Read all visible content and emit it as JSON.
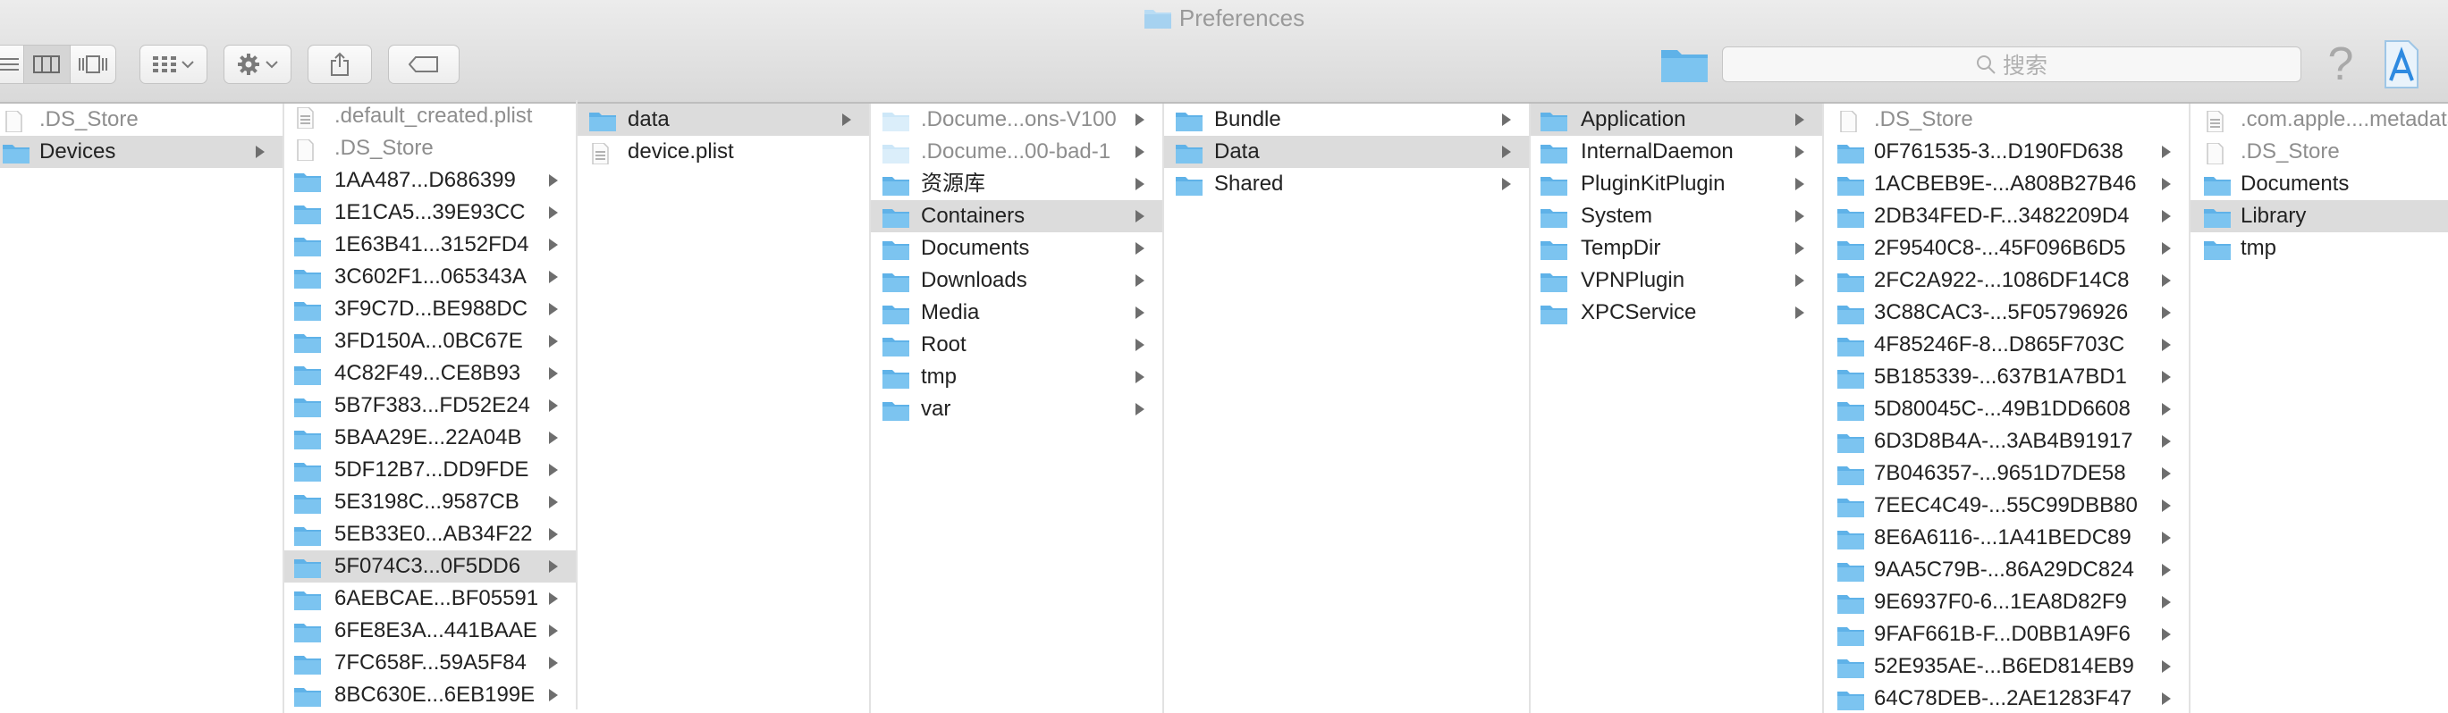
{
  "window": {
    "title": "Preferences"
  },
  "toolbar": {
    "search_placeholder": "搜索",
    "help_label": "?"
  },
  "columns": [
    {
      "items": [
        {
          "label": ".DS_Store",
          "type": "file",
          "dim": true
        },
        {
          "label": "Devices",
          "type": "folder",
          "arrow": true,
          "selected": true
        }
      ]
    },
    {
      "items": [
        {
          "label": ".default_created.plist",
          "type": "plist",
          "dim": true
        },
        {
          "label": ".DS_Store",
          "type": "file",
          "dim": true
        },
        {
          "label": "1AA487...D686399",
          "type": "folder",
          "arrow": true
        },
        {
          "label": "1E1CA5...39E93CC",
          "type": "folder",
          "arrow": true
        },
        {
          "label": "1E63B41...3152FD4",
          "type": "folder",
          "arrow": true
        },
        {
          "label": "3C602F1...065343A",
          "type": "folder",
          "arrow": true
        },
        {
          "label": "3F9C7D...BE988DC",
          "type": "folder",
          "arrow": true
        },
        {
          "label": "3FD150A...0BC67E",
          "type": "folder",
          "arrow": true
        },
        {
          "label": "4C82F49...CE8B93",
          "type": "folder",
          "arrow": true
        },
        {
          "label": "5B7F383...FD52E24",
          "type": "folder",
          "arrow": true
        },
        {
          "label": "5BAA29E...22A04B",
          "type": "folder",
          "arrow": true
        },
        {
          "label": "5DF12B7...DD9FDE",
          "type": "folder",
          "arrow": true
        },
        {
          "label": "5E3198C...9587CB",
          "type": "folder",
          "arrow": true
        },
        {
          "label": "5EB33E0...AB34F22",
          "type": "folder",
          "arrow": true
        },
        {
          "label": "5F074C3...0F5DD6",
          "type": "folder",
          "arrow": true,
          "selected": true
        },
        {
          "label": "6AEBCAE...BF05591",
          "type": "folder",
          "arrow": true
        },
        {
          "label": "6FE8E3A...441BAAE",
          "type": "folder",
          "arrow": true
        },
        {
          "label": "7FC658F...59A5F84",
          "type": "folder",
          "arrow": true
        },
        {
          "label": "8BC630E...6EB199E",
          "type": "folder",
          "arrow": true
        }
      ]
    },
    {
      "items": [
        {
          "label": "data",
          "type": "folder",
          "arrow": true,
          "selected": true
        },
        {
          "label": "device.plist",
          "type": "plist"
        }
      ]
    },
    {
      "items": [
        {
          "label": ".Docume...ons-V100",
          "type": "folder-light",
          "arrow": true,
          "dim": true
        },
        {
          "label": ".Docume...00-bad-1",
          "type": "folder-light",
          "arrow": true,
          "dim": true
        },
        {
          "label": "资源库",
          "type": "folder",
          "arrow": true
        },
        {
          "label": "Containers",
          "type": "folder",
          "arrow": true,
          "selected": true
        },
        {
          "label": "Documents",
          "type": "folder",
          "arrow": true
        },
        {
          "label": "Downloads",
          "type": "folder",
          "arrow": true
        },
        {
          "label": "Media",
          "type": "folder",
          "arrow": true
        },
        {
          "label": "Root",
          "type": "folder",
          "arrow": true
        },
        {
          "label": "tmp",
          "type": "folder",
          "arrow": true
        },
        {
          "label": "var",
          "type": "folder",
          "arrow": true
        }
      ]
    },
    {
      "items": [
        {
          "label": "Bundle",
          "type": "folder",
          "arrow": true
        },
        {
          "label": "Data",
          "type": "folder",
          "arrow": true,
          "selected": true
        },
        {
          "label": "Shared",
          "type": "folder",
          "arrow": true
        }
      ]
    },
    {
      "items": [
        {
          "label": "Application",
          "type": "folder",
          "arrow": true,
          "selected": true
        },
        {
          "label": "InternalDaemon",
          "type": "folder",
          "arrow": true
        },
        {
          "label": "PluginKitPlugin",
          "type": "folder",
          "arrow": true
        },
        {
          "label": "System",
          "type": "folder",
          "arrow": true
        },
        {
          "label": "TempDir",
          "type": "folder",
          "arrow": true
        },
        {
          "label": "VPNPlugin",
          "type": "folder",
          "arrow": true
        },
        {
          "label": "XPCService",
          "type": "folder",
          "arrow": true
        }
      ]
    },
    {
      "items": [
        {
          "label": ".DS_Store",
          "type": "file",
          "dim": true
        },
        {
          "label": "0F761535-3...D190FD638",
          "type": "folder",
          "arrow": true
        },
        {
          "label": "1ACBEB9E-...A808B27B46",
          "type": "folder",
          "arrow": true
        },
        {
          "label": "2DB34FED-F...3482209D4",
          "type": "folder",
          "arrow": true
        },
        {
          "label": "2F9540C8-...45F096B6D5",
          "type": "folder",
          "arrow": true
        },
        {
          "label": "2FC2A922-...1086DF14C8",
          "type": "folder",
          "arrow": true
        },
        {
          "label": "3C88CAC3-...5F05796926",
          "type": "folder",
          "arrow": true
        },
        {
          "label": "4F85246F-8...D865F703C",
          "type": "folder",
          "arrow": true
        },
        {
          "label": "5B185339-...637B1A7BD1",
          "type": "folder",
          "arrow": true
        },
        {
          "label": "5D80045C-...49B1DD6608",
          "type": "folder",
          "arrow": true
        },
        {
          "label": "6D3D8B4A-...3AB4B91917",
          "type": "folder",
          "arrow": true
        },
        {
          "label": "7B046357-...9651D7DE58",
          "type": "folder",
          "arrow": true
        },
        {
          "label": "7EEC4C49-...55C99DBB80",
          "type": "folder",
          "arrow": true
        },
        {
          "label": "8E6A6116-...1A41BEDC89",
          "type": "folder",
          "arrow": true
        },
        {
          "label": "9AA5C79B-...86A29DC824",
          "type": "folder",
          "arrow": true
        },
        {
          "label": "9E6937F0-6...1EA8D82F9",
          "type": "folder",
          "arrow": true
        },
        {
          "label": "9FAF661B-F...D0BB1A9F6",
          "type": "folder",
          "arrow": true
        },
        {
          "label": "52E935AE-...B6ED814EB9",
          "type": "folder",
          "arrow": true
        },
        {
          "label": "64C78DEB-...2AE1283F47",
          "type": "folder",
          "arrow": true
        }
      ]
    },
    {
      "items": [
        {
          "label": ".com.apple....metadata",
          "type": "plist",
          "dim": true
        },
        {
          "label": ".DS_Store",
          "type": "file",
          "dim": true
        },
        {
          "label": "Documents",
          "type": "folder"
        },
        {
          "label": "Library",
          "type": "folder",
          "selected": true
        },
        {
          "label": "tmp",
          "type": "folder"
        }
      ]
    }
  ],
  "colors": {
    "folder": "#7cc4f0",
    "folder_dark": "#5fb2e8",
    "selection": "#dcdcdc"
  }
}
